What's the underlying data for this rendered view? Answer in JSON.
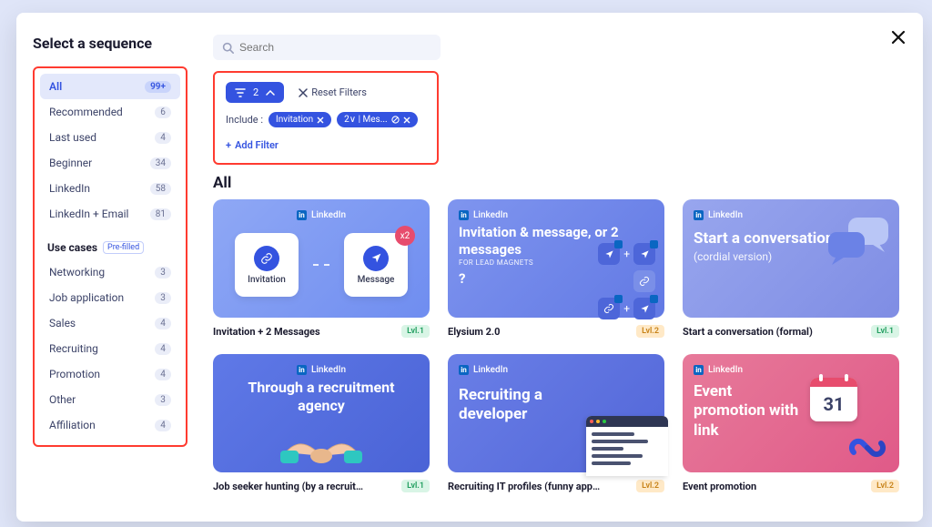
{
  "title": "Select a sequence",
  "search": {
    "placeholder": "Search"
  },
  "sidebar": {
    "cats": [
      {
        "label": "All",
        "count": "99+",
        "active": true
      },
      {
        "label": "Recommended",
        "count": "6"
      },
      {
        "label": "Last used",
        "count": "4"
      },
      {
        "label": "Beginner",
        "count": "34"
      },
      {
        "label": "LinkedIn",
        "count": "58"
      },
      {
        "label": "LinkedIn + Email",
        "count": "81"
      }
    ],
    "section": {
      "title": "Use cases",
      "badge": "Pre-filled"
    },
    "uses": [
      {
        "label": "Networking",
        "count": "3"
      },
      {
        "label": "Job application",
        "count": "3"
      },
      {
        "label": "Sales",
        "count": "4"
      },
      {
        "label": "Recruiting",
        "count": "4"
      },
      {
        "label": "Promotion",
        "count": "4"
      },
      {
        "label": "Other",
        "count": "3"
      },
      {
        "label": "Affiliation",
        "count": "4"
      }
    ]
  },
  "filters": {
    "count": "2",
    "reset": "Reset Filters",
    "include_label": "Include :",
    "chips": [
      {
        "label": "Invitation"
      },
      {
        "label": "2∨ | Mes..."
      }
    ],
    "add": "Add Filter"
  },
  "section_heading": "All",
  "li_label": "LinkedIn",
  "cards": {
    "0": {
      "title": "Invitation + 2 Messages",
      "lvl": "Lvl.1",
      "t1": "Invitation",
      "t2": "Message",
      "x2": "x2"
    },
    "1": {
      "title": "Elysium 2.0",
      "lvl": "Lvl.2",
      "headline": "Invitation & message, or 2 messages",
      "sub": "FOR LEAD MAGNETS"
    },
    "2": {
      "title": "Start a conversation (formal)",
      "lvl": "Lvl.1",
      "headline": "Start a conversation",
      "sub": "(cordial version)"
    },
    "3": {
      "title": "Job seeker hunting (by a recruitment",
      "lvl": "Lvl.1",
      "headline": "Through a recruitment agency"
    },
    "4": {
      "title": "Recruiting IT profiles (funny approach)",
      "lvl": "Lvl.2",
      "headline": "Recruiting a developer"
    },
    "5": {
      "title": "Event promotion",
      "lvl": "Lvl.2",
      "headline": "Event promotion with link",
      "cal": "31"
    }
  }
}
